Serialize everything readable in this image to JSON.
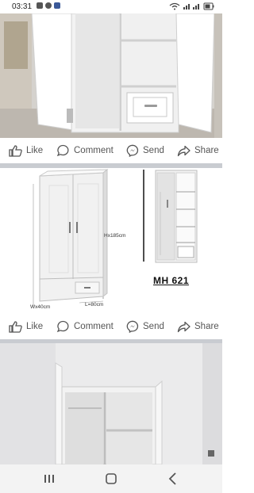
{
  "status_bar": {
    "time": "03:31",
    "notification_icons": [
      "gmail-icon",
      "whatsapp-icon",
      "facebook-icon"
    ],
    "system_icons": [
      "wifi-icon",
      "signal-icon",
      "signal-icon",
      "battery-icon"
    ]
  },
  "post_actions": {
    "like": "Like",
    "comment": "Comment",
    "send": "Send",
    "share": "Share"
  },
  "product_image": {
    "height_label": "Hx185cm",
    "width_label": "Wx40cm",
    "length_label": "L=80cm",
    "model_code": "MH 621"
  },
  "nav_bar": {
    "buttons": [
      "recent-apps",
      "home",
      "back"
    ]
  },
  "colors": {
    "divider": "#c9ccd1",
    "action_text": "#555555",
    "nav_background": "#f3f3f3"
  }
}
